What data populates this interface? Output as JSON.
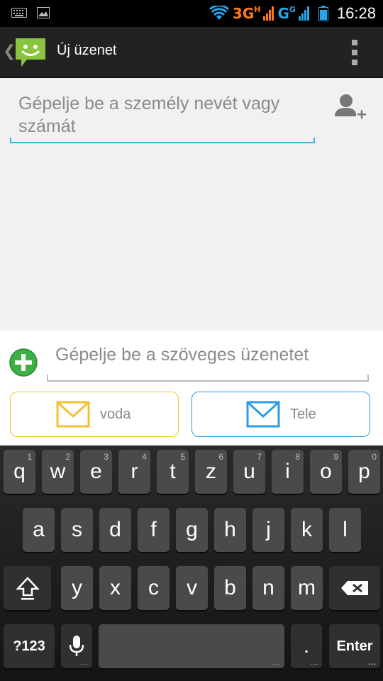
{
  "status_bar": {
    "network_primary": "3G",
    "network_primary_sup": "H",
    "network_secondary": "G",
    "network_secondary_sup": "G",
    "time": "16:28",
    "icons": [
      "keyboard-icon",
      "image-icon",
      "wifi-icon",
      "signal-icon",
      "battery-icon"
    ]
  },
  "action_bar": {
    "title": "Új üzenet",
    "back_glyph": "❮",
    "icons": [
      "messaging-logo-icon",
      "overflow-menu-icon"
    ]
  },
  "recipient": {
    "placeholder": "Gépelje be a személy nevét vagy számát"
  },
  "compose": {
    "placeholder": "Gépelje be a szöveges üzenetet",
    "sim_buttons": [
      {
        "label": "voda",
        "color": "#f2c230"
      },
      {
        "label": "Tele",
        "color": "#2e9be6"
      }
    ]
  },
  "colors": {
    "accent": "#33b5e5",
    "attach_green": "#3cb043"
  },
  "keyboard": {
    "row1": [
      {
        "k": "q",
        "h": "1"
      },
      {
        "k": "w",
        "h": "2"
      },
      {
        "k": "e",
        "h": "3"
      },
      {
        "k": "r",
        "h": "4"
      },
      {
        "k": "t",
        "h": "5"
      },
      {
        "k": "z",
        "h": "6"
      },
      {
        "k": "u",
        "h": "7"
      },
      {
        "k": "i",
        "h": "8"
      },
      {
        "k": "o",
        "h": "9"
      },
      {
        "k": "p",
        "h": "0"
      }
    ],
    "row2": [
      "a",
      "s",
      "d",
      "f",
      "g",
      "h",
      "j",
      "k",
      "l"
    ],
    "row3": [
      "y",
      "x",
      "c",
      "v",
      "b",
      "n",
      "m"
    ],
    "symbols_label": "?123",
    "period_label": ".",
    "enter_label": "Enter"
  }
}
